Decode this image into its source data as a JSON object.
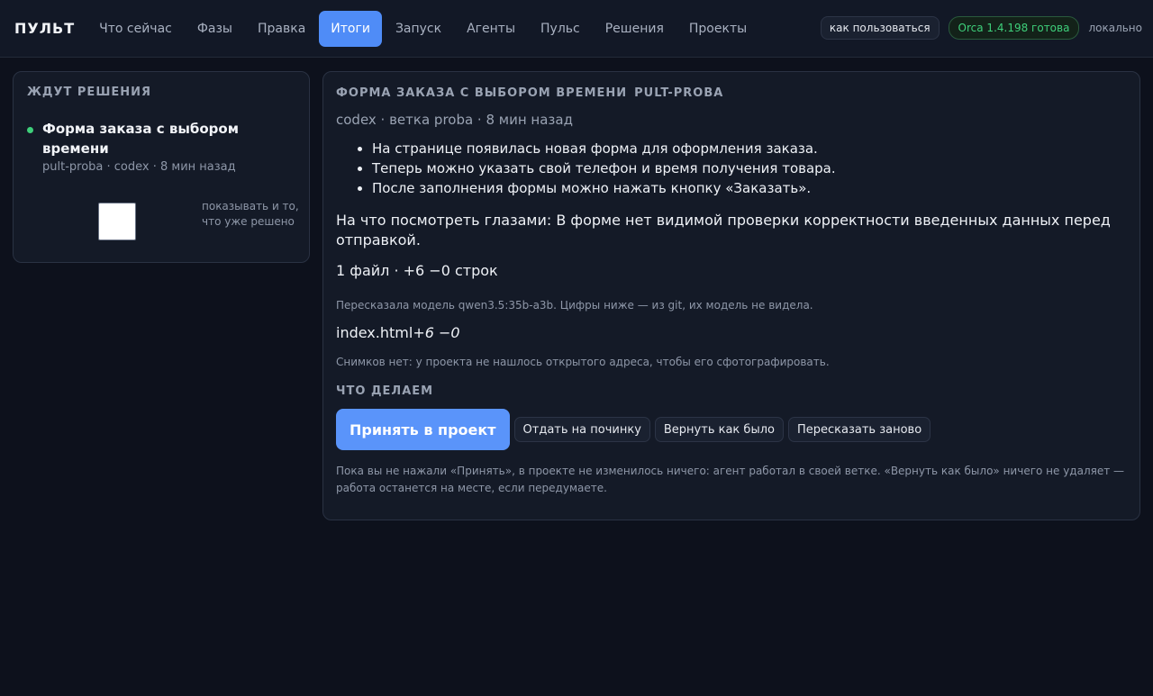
{
  "brand": "ПУЛЬТ",
  "nav": {
    "tabs": [
      {
        "label": "Что сейчас"
      },
      {
        "label": "Фазы"
      },
      {
        "label": "Правка"
      },
      {
        "label": "Итоги",
        "active": true
      },
      {
        "label": "Запуск"
      },
      {
        "label": "Агенты"
      },
      {
        "label": "Пульс"
      },
      {
        "label": "Решения"
      },
      {
        "label": "Проекты"
      }
    ]
  },
  "header_right": {
    "help_label": "как пользоваться",
    "status_label": "Orca 1.4.198 готова",
    "mode_label": "локально"
  },
  "sidebar": {
    "title": "ЖДУТ РЕШЕНИЯ",
    "item": {
      "title": "Форма заказа с выбором времени",
      "meta": "pult-proba · codex · 8 мин назад"
    },
    "toggle_label": "показывать и то, что уже решено"
  },
  "main": {
    "task_title": "ФОРМА ЗАКАЗА С ВЫБОРОМ ВРЕМЕНИ",
    "task_project": "PULT-PROBA",
    "meta": "codex · ветка proba · 8 мин назад",
    "summary": [
      "На странице появилась новая форма для оформления заказа.",
      "Теперь можно указать свой телефон и время получения товара.",
      "После заполнения формы можно нажать кнопку «Заказать»."
    ],
    "attention": "На что посмотреть глазами: В форме нет видимой проверки корректности введенных данных перед отправкой.",
    "diff_stats": "1 файл · +6 −0 строк",
    "model_note": "Пересказала модель qwen3.5:35b-a3b. Цифры ниже — из git, их модель не видела.",
    "file_name": "index.html",
    "file_delta": "+6 −0",
    "snapshots_note": "Снимков нет: у проекта не нашлось открытого адреса, чтобы его сфотографировать.",
    "actions_title": "ЧТО ДЕЛАЕМ",
    "actions": {
      "accept": "Принять в проект",
      "repair": "Отдать на починку",
      "revert": "Вернуть как было",
      "retell": "Пересказать заново"
    },
    "footnote": "Пока вы не нажали «Принять», в проекте не изменилось ничего: агент работал в своей ветке. «Вернуть как было» ничего не удаляет — работа останется на месте, если передумаете."
  }
}
